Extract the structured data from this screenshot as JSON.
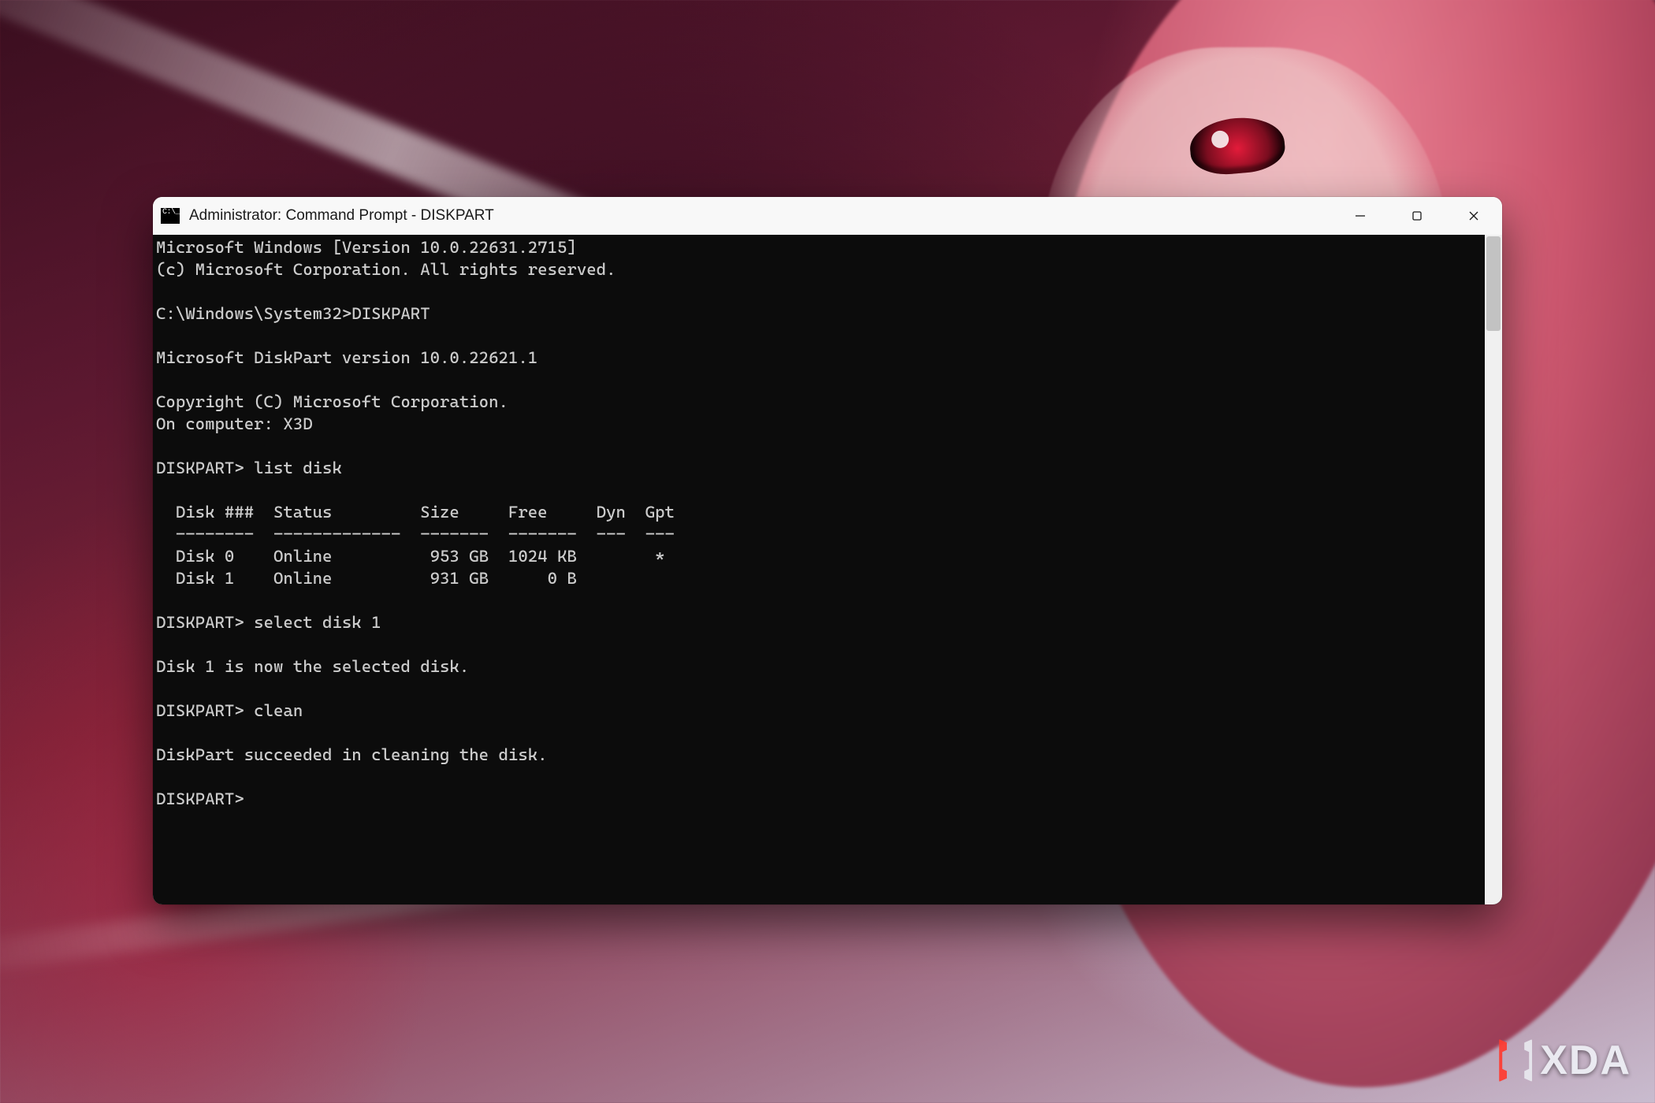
{
  "window": {
    "title": "Administrator: Command Prompt - DISKPART"
  },
  "terminal": {
    "header_line1": "Microsoft Windows [Version 10.0.22631.2715]",
    "header_line2": "(c) Microsoft Corporation. All rights reserved.",
    "prompt_path": "C:\\Windows\\System32>",
    "cmd_diskpart": "DISKPART",
    "dp_version": "Microsoft DiskPart version 10.0.22621.1",
    "dp_copyright": "Copyright (C) Microsoft Corporation.",
    "dp_computer": "On computer: X3D",
    "dp_prompt": "DISKPART>",
    "cmd_list": "list disk",
    "table_header": "  Disk ###  Status         Size     Free     Dyn  Gpt",
    "table_divider": "  --------  -------------  -------  -------  ---  ---",
    "row0": "  Disk 0    Online          953 GB  1024 KB        *",
    "row1": "  Disk 1    Online          931 GB      0 B",
    "cmd_select": "select disk 1",
    "select_resp": "Disk 1 is now the selected disk.",
    "cmd_clean": "clean",
    "clean_resp": "DiskPart succeeded in cleaning the disk.",
    "disks": [
      {
        "id": "Disk 0",
        "status": "Online",
        "size": "953 GB",
        "free": "1024 KB",
        "dyn": "",
        "gpt": "*"
      },
      {
        "id": "Disk 1",
        "status": "Online",
        "size": "931 GB",
        "free": "0 B",
        "dyn": "",
        "gpt": ""
      }
    ]
  },
  "watermark": {
    "text": "XDA"
  }
}
